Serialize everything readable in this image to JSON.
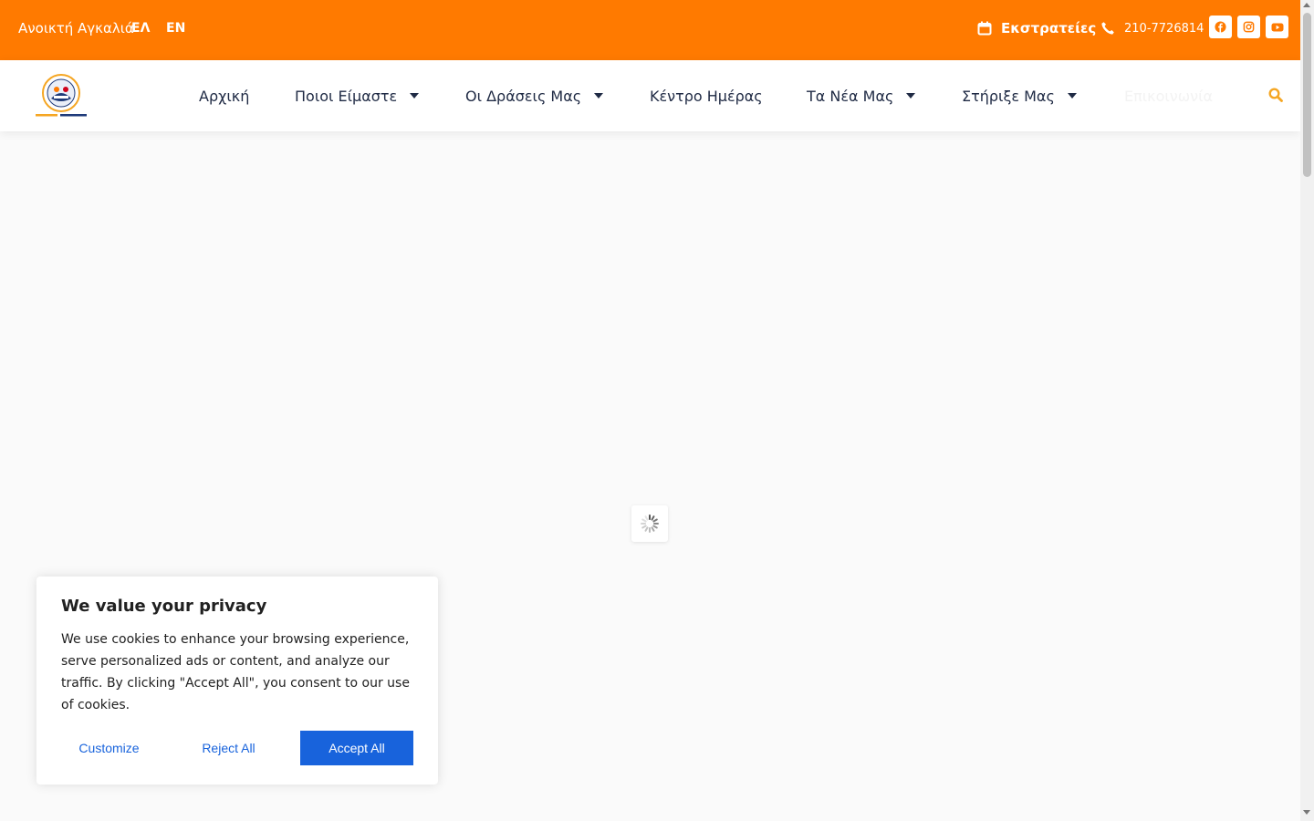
{
  "topbar": {
    "brand": "Ανοικτή Αγκαλιά",
    "lang_el": "ΕΛ",
    "lang_en": "EN",
    "campaigns_label": "Εκστρατείες",
    "phone": "210-7726814",
    "background_color": "#ff7a00"
  },
  "nav": {
    "home": "Αρχική",
    "who_we_are": "Ποιοι Είμαστε",
    "our_actions": "Οι Δράσεις Μας",
    "day_center": "Κέντρο Ημέρας",
    "news": "Τα Νέα Μας",
    "support": "Στήριξε Μας",
    "contact": "Επικοινωνία",
    "text_color": "#1f2a44",
    "search_icon_color": "#f5a623"
  },
  "cookie": {
    "title": "We value your privacy",
    "text": "We use cookies to enhance your browsing experience, serve personalized ads or content, and analyze our traffic. By clicking \"Accept All\", you consent to our use of cookies.",
    "customize": "Customize",
    "reject_all": "Reject All",
    "accept_all": "Accept All",
    "accent_color": "#1863dc"
  }
}
